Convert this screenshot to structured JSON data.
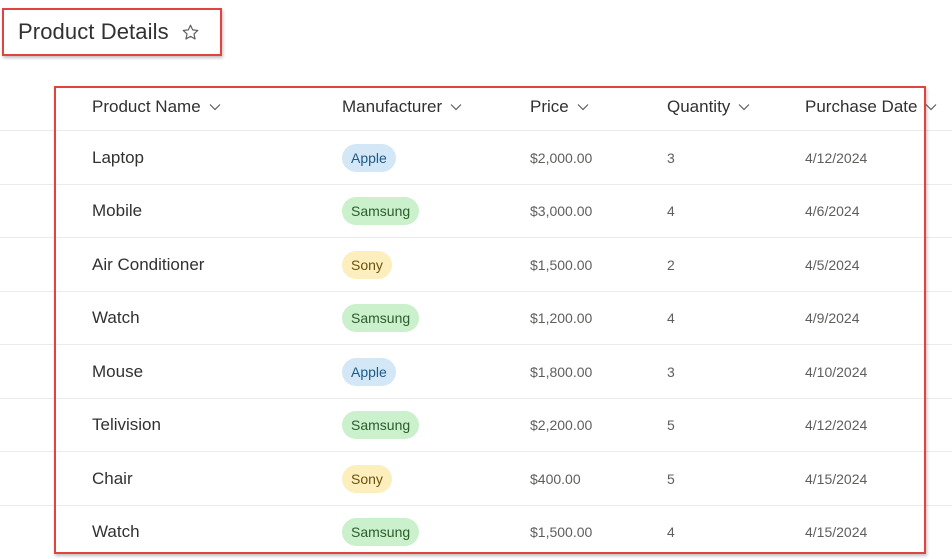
{
  "title": "Product Details",
  "columns": [
    {
      "label": "Product Name"
    },
    {
      "label": "Manufacturer"
    },
    {
      "label": "Price"
    },
    {
      "label": "Quantity"
    },
    {
      "label": "Purchase Date"
    }
  ],
  "rows": [
    {
      "name": "Laptop",
      "manufacturer": "Apple",
      "price": "$2,000.00",
      "quantity": "3",
      "date": "4/12/2024"
    },
    {
      "name": "Mobile",
      "manufacturer": "Samsung",
      "price": "$3,000.00",
      "quantity": "4",
      "date": "4/6/2024"
    },
    {
      "name": "Air Conditioner",
      "manufacturer": "Sony",
      "price": "$1,500.00",
      "quantity": "2",
      "date": "4/5/2024"
    },
    {
      "name": "Watch",
      "manufacturer": "Samsung",
      "price": "$1,200.00",
      "quantity": "4",
      "date": "4/9/2024"
    },
    {
      "name": "Mouse",
      "manufacturer": "Apple",
      "price": "$1,800.00",
      "quantity": "3",
      "date": "4/10/2024"
    },
    {
      "name": "Telivision",
      "manufacturer": "Samsung",
      "price": "$2,200.00",
      "quantity": "5",
      "date": "4/12/2024"
    },
    {
      "name": "Chair",
      "manufacturer": "Sony",
      "price": "$400.00",
      "quantity": "5",
      "date": "4/15/2024"
    },
    {
      "name": "Watch",
      "manufacturer": "Samsung",
      "price": "$1,500.00",
      "quantity": "4",
      "date": "4/15/2024"
    }
  ],
  "manufacturer_colors": {
    "Apple": {
      "bg": "#d4e7f6",
      "fg": "#1b5a8a"
    },
    "Samsung": {
      "bg": "#caf0cc",
      "fg": "#2d5c2d"
    },
    "Sony": {
      "bg": "#fcefbd",
      "fg": "#6b5210"
    }
  },
  "icons": {
    "favorite": "star-outline-icon",
    "sort": "chevron-down-icon"
  },
  "highlight_color": "#e0443e"
}
